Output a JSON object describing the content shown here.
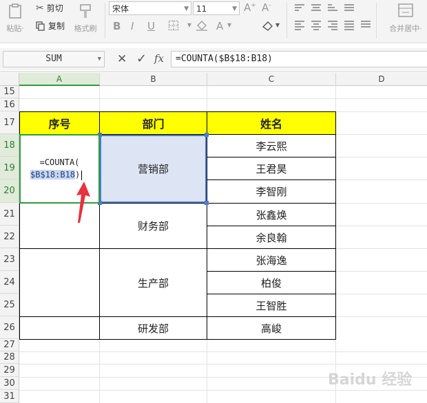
{
  "ribbon": {
    "paste_label": "粘贴·",
    "cut_label": "剪切",
    "copy_label": "复制",
    "format_painter_label": "格式刷",
    "font_name": "宋体",
    "font_size": "11",
    "merge_center_label": "合并居中·",
    "icons": [
      "paste-icon",
      "scissors-icon",
      "copy-icon",
      "brush-icon",
      "bold-icon",
      "italic-icon",
      "underline-icon",
      "border-icon",
      "fill-color-icon",
      "font-color-icon",
      "eraser-icon",
      "grow-font-icon",
      "shrink-font-icon"
    ]
  },
  "formula_bar": {
    "name_box": "SUM",
    "cancel_symbol": "✕",
    "enter_symbol": "✓",
    "fx_label": "fx",
    "formula": "=COUNTA($B$18:B18)"
  },
  "columns": [
    "A",
    "B",
    "C",
    "D"
  ],
  "rows": [
    "15",
    "16",
    "17",
    "18",
    "19",
    "20",
    "21",
    "22",
    "23",
    "24",
    "25",
    "26",
    "27",
    "28",
    "29",
    "30",
    "31"
  ],
  "table": {
    "headers": {
      "seq": "序号",
      "dept": "部门",
      "name": "姓名"
    },
    "editing_line1": "=COUNTA(",
    "editing_line2": "$B$18:B18",
    "editing_line2_tail": ")",
    "departments": [
      "营销部",
      "财务部",
      "生产部",
      "研发部"
    ],
    "names": [
      "李云熙",
      "王君昊",
      "李智刚",
      "张鑫焕",
      "余良翰",
      "张海逸",
      "柏俊",
      "王智胜",
      "高峻"
    ]
  },
  "watermark": "Baidu 经验",
  "colors": {
    "header_fill": "#ffff00",
    "selection": "#dde4f3",
    "selection_border": "#4a7dd4",
    "active_border": "#2e9b3f",
    "arrow": "#e8323c"
  }
}
